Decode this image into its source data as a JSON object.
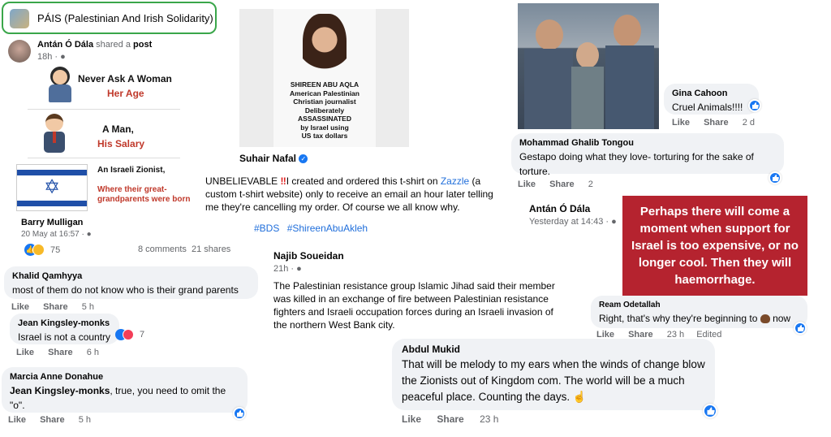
{
  "group": {
    "name": "PÁIS (Palestinian And Irish Solidarity)"
  },
  "post1": {
    "author": "Antán Ó Dála",
    "action_text": "shared a",
    "action_link": "post",
    "time": "18h",
    "meme": {
      "line1": "Never Ask A Woman",
      "line2": "Her Age",
      "line3": "A Man,",
      "line4": "His Salary",
      "line5": "An Israeli Zionist,",
      "line6": "Where their great-grandparents were born"
    },
    "share_author": "Barry Mulligan",
    "share_time": "20 May at 16:57",
    "reactions_count": "75",
    "comments": "8 comments",
    "shares": "21 shares"
  },
  "comments_left": [
    {
      "author": "Khalid Qamhyya",
      "text": "most of them do not know who is their grand parents",
      "like": "Like",
      "share": "Share",
      "time": "5 h"
    },
    {
      "author": "Jean Kingsley-monks",
      "text": "Israel is not a country",
      "like": "Like",
      "share": "Share",
      "time": "6 h",
      "count": "7"
    },
    {
      "author": "Marcia Anne Donahue",
      "mention": "Jean Kingsley-monks",
      "text": ", true, you need to omit the \"o\".",
      "like": "Like",
      "share": "Share",
      "time": "5 h"
    }
  ],
  "tshirt_post": {
    "shirt_line1": "SHIREEN ABU AQLA",
    "shirt_line2": "American Palestinian",
    "shirt_line3": "Christian journalist",
    "shirt_line4": "Deliberately ASSASSINATED",
    "shirt_line5": "by Israel using",
    "shirt_line6": "US tax dollars",
    "author": "Suhair Nafal",
    "text_before": "UNBELIEVABLE ",
    "text_mid": "I created and ordered this t-shirt on ",
    "text_link": "Zazzle",
    "text_after": " (a custom t-shirt website) only to receive an email an hour later telling me they're cancelling my order. Of course we all know why.",
    "hashtag1": "#BDS",
    "hashtag2": "#ShireenAbuAkleh"
  },
  "najib_post": {
    "author": "Najib Soueidan",
    "time": "21h",
    "text": "The Palestinian resistance group Islamic Jihad said their member was killed in an exchange of fire between Palestinian resistance fighters and Israeli occupation forces during an Israeli invasion of the northern West Bank city."
  },
  "abdul_comment": {
    "author": "Abdul Mukid",
    "text": "That will be melody to my ears when the winds of change blow the Zionists out of Kingdom com. The world will be a much peaceful place. Counting the days.",
    "like": "Like",
    "share": "Share",
    "time": "23 h"
  },
  "photo_comments": [
    {
      "author": "Gina Cahoon",
      "text": "Cruel Animals!!!!",
      "like": "Like",
      "share": "Share",
      "time": "2 d"
    },
    {
      "author": "Mohammad Ghalib Tongou",
      "text": "Gestapo doing what they love- torturing for the sake of torture.",
      "like": "Like",
      "share": "Share",
      "time": "2"
    }
  ],
  "antan_post2": {
    "author": "Antán Ó Dála",
    "time": "Yesterday at 14:43",
    "quote": "Perhaps there will come a moment when support for Israel is too expensive, or no longer cool. Then they will haemorrhage.",
    "quote_bg": "#b5232f"
  },
  "ream_comment": {
    "author": "Ream Odetallah",
    "text_before": "Right, that's why they're beginning to",
    "text_after": "now",
    "like": "Like",
    "share": "Share",
    "time": "23 h",
    "edited": "Edited"
  },
  "colors": {
    "accent": "#1877f2",
    "group_border": "#2ea043"
  }
}
